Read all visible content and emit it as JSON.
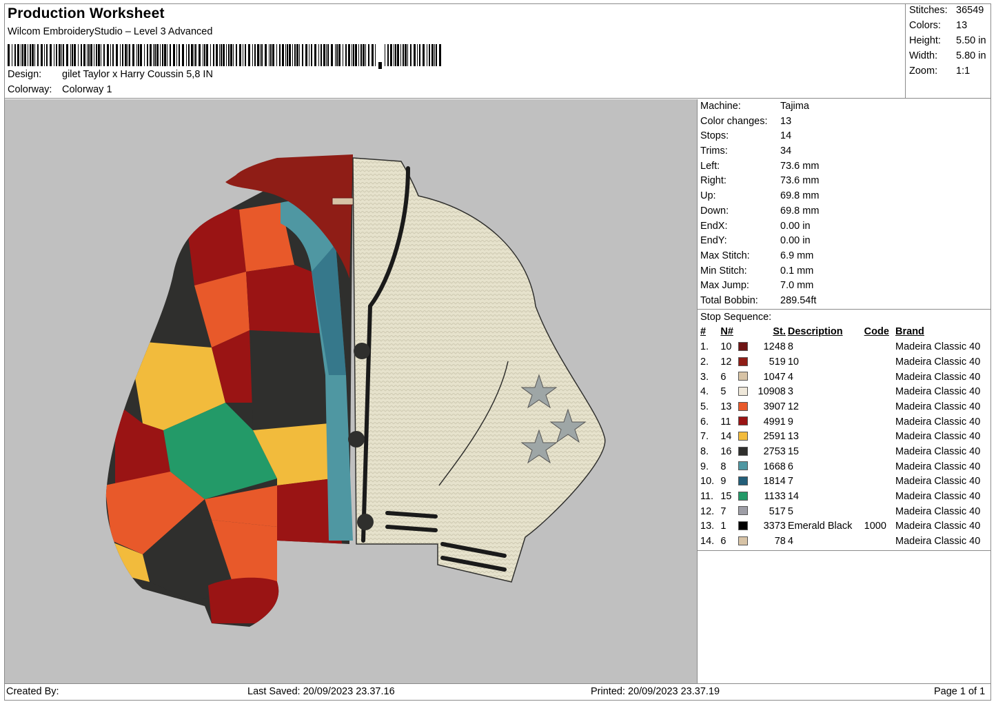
{
  "header": {
    "title": "Production Worksheet",
    "subtitle": "Wilcom EmbroideryStudio – Level 3 Advanced",
    "design_label": "Design:",
    "design_value": "gilet Taylor x Harry Coussin 5,8 IN",
    "colorway_label": "Colorway:",
    "colorway_value": "Colorway 1"
  },
  "stats": [
    {
      "label": "Stitches:",
      "value": "36549"
    },
    {
      "label": "Colors:",
      "value": "13"
    },
    {
      "label": "Height:",
      "value": "5.50 in"
    },
    {
      "label": "Width:",
      "value": "5.80 in"
    },
    {
      "label": "Zoom:",
      "value": "1:1"
    }
  ],
  "machine": [
    {
      "label": "Machine:",
      "value": "Tajima"
    },
    {
      "label": "Color changes:",
      "value": "13"
    },
    {
      "label": "Stops:",
      "value": "14"
    },
    {
      "label": "Trims:",
      "value": "34"
    },
    {
      "label": "Left:",
      "value": "73.6 mm"
    },
    {
      "label": "Right:",
      "value": "73.6 mm"
    },
    {
      "label": "Up:",
      "value": "69.8 mm"
    },
    {
      "label": "Down:",
      "value": "69.8 mm"
    },
    {
      "label": "EndX:",
      "value": "0.00 in"
    },
    {
      "label": "EndY:",
      "value": "0.00 in"
    },
    {
      "label": "Max Stitch:",
      "value": "6.9 mm"
    },
    {
      "label": "Min Stitch:",
      "value": "0.1 mm"
    },
    {
      "label": "Max Jump:",
      "value": "7.0 mm"
    },
    {
      "label": "Total Bobbin:",
      "value": "289.54ft"
    }
  ],
  "stop_sequence": {
    "title": "Stop Sequence:",
    "columns": [
      "#",
      "N#",
      "St.",
      "Description",
      "Code",
      "Brand"
    ],
    "rows": [
      {
        "idx": "1.",
        "n": "10",
        "color": "#6e1414",
        "st": "1248",
        "desc": "8",
        "code": "",
        "brand": "Madeira Classic 40"
      },
      {
        "idx": "2.",
        "n": "12",
        "color": "#8f1d16",
        "st": "519",
        "desc": "10",
        "code": "",
        "brand": "Madeira Classic 40"
      },
      {
        "idx": "3.",
        "n": "6",
        "color": "#d7c3a6",
        "st": "1047",
        "desc": "4",
        "code": "",
        "brand": "Madeira Classic 40"
      },
      {
        "idx": "4.",
        "n": "5",
        "color": "#efe8da",
        "st": "10908",
        "desc": "3",
        "code": "",
        "brand": "Madeira Classic 40"
      },
      {
        "idx": "5.",
        "n": "13",
        "color": "#e8592a",
        "st": "3907",
        "desc": "12",
        "code": "",
        "brand": "Madeira Classic 40"
      },
      {
        "idx": "6.",
        "n": "11",
        "color": "#9a1414",
        "st": "4991",
        "desc": "9",
        "code": "",
        "brand": "Madeira Classic 40"
      },
      {
        "idx": "7.",
        "n": "14",
        "color": "#f2bb3c",
        "st": "2591",
        "desc": "13",
        "code": "",
        "brand": "Madeira Classic 40"
      },
      {
        "idx": "8.",
        "n": "16",
        "color": "#2f2f2d",
        "st": "2753",
        "desc": "15",
        "code": "",
        "brand": "Madeira Classic 40"
      },
      {
        "idx": "9.",
        "n": "8",
        "color": "#4f97a2",
        "st": "1668",
        "desc": "6",
        "code": "",
        "brand": "Madeira Classic 40"
      },
      {
        "idx": "10.",
        "n": "9",
        "color": "#235e79",
        "st": "1814",
        "desc": "7",
        "code": "",
        "brand": "Madeira Classic 40"
      },
      {
        "idx": "11.",
        "n": "15",
        "color": "#239a68",
        "st": "1133",
        "desc": "14",
        "code": "",
        "brand": "Madeira Classic 40"
      },
      {
        "idx": "12.",
        "n": "7",
        "color": "#9e9ea6",
        "st": "517",
        "desc": "5",
        "code": "",
        "brand": "Madeira Classic 40"
      },
      {
        "idx": "13.",
        "n": "1",
        "color": "#000000",
        "st": "3373",
        "desc": "Emerald Black",
        "code": "1000",
        "brand": "Madeira Classic 40"
      },
      {
        "idx": "14.",
        "n": "6",
        "color": "#d7c3a6",
        "st": "78",
        "desc": "4",
        "code": "",
        "brand": "Madeira Classic 40"
      }
    ]
  },
  "footer": {
    "created_by": "Created By:",
    "last_saved": "Last Saved: 20/09/2023 23.37.16",
    "printed": "Printed: 20/09/2023 23.37.19",
    "page": "Page 1 of 1"
  }
}
